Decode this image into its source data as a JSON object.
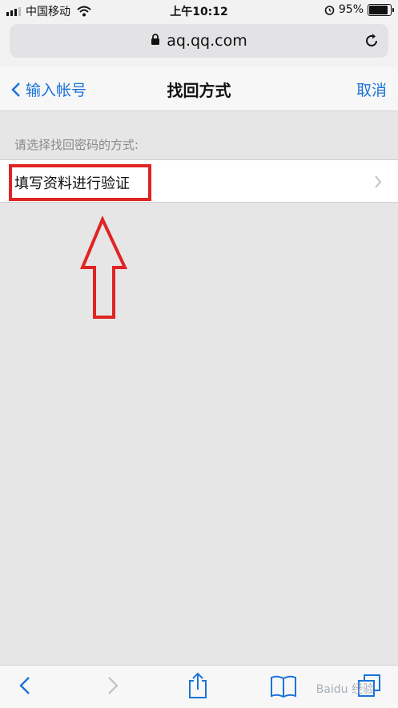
{
  "status_bar": {
    "carrier": "中国移动",
    "time": "上午10:12",
    "battery_percent": "95%",
    "battery_level": 0.95,
    "signal_bars_active": 3,
    "signal_bars_total": 4
  },
  "browser": {
    "url": "aq.qq.com"
  },
  "nav": {
    "back_label": "输入帐号",
    "title": "找回方式",
    "cancel_label": "取消"
  },
  "content": {
    "section_label": "请选择找回密码的方式:",
    "options": [
      {
        "label": "填写资料进行验证"
      }
    ]
  },
  "annotation": {
    "color": "#e02424"
  },
  "watermark": {
    "text": "Baidu 经验"
  },
  "colors": {
    "accent": "#1a73d9",
    "background": "#e6e6e6"
  }
}
